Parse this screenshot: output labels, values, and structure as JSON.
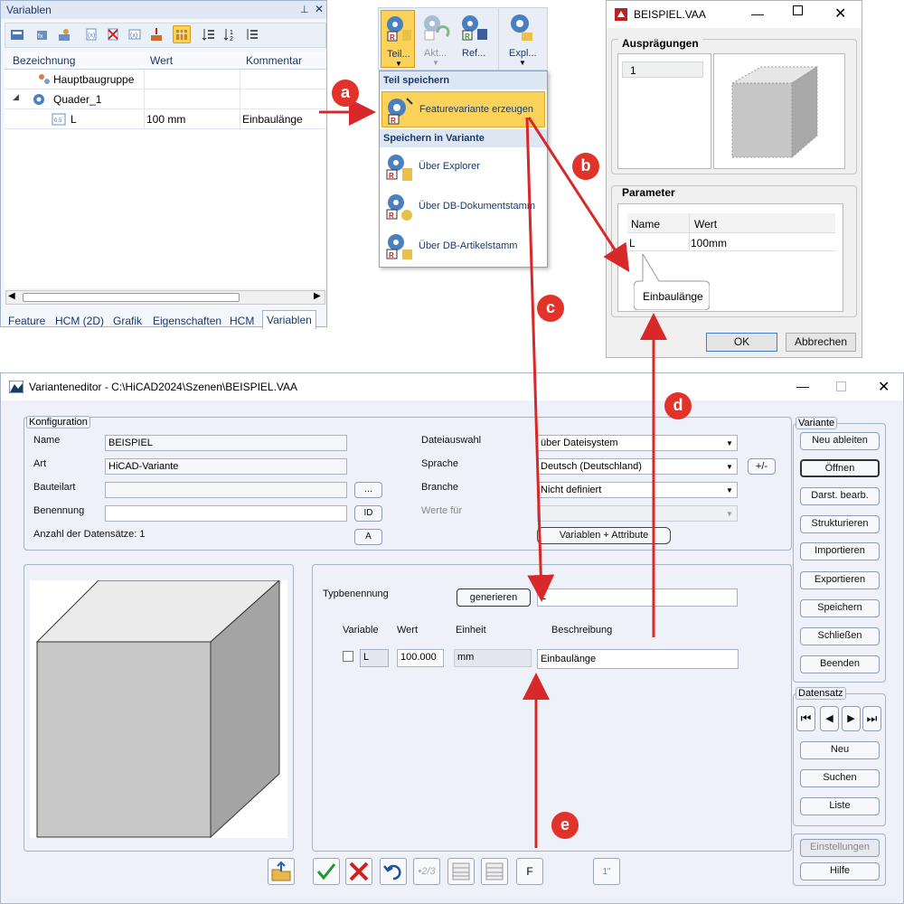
{
  "var_panel": {
    "title": "Variablen",
    "pin": "⊥",
    "close": "✕",
    "columns": [
      "Bezeichnung",
      "Wert",
      "Kommentar"
    ],
    "rows": [
      {
        "name": "Hauptbaugruppe",
        "value": "",
        "comment": ""
      },
      {
        "name": "Quader_1",
        "value": "",
        "comment": ""
      },
      {
        "name": "L",
        "value": "100 mm",
        "comment": "Einbaulänge"
      }
    ],
    "tabs": [
      "Feature",
      "HCM (2D)",
      "Grafik",
      "Eigenschaften",
      "HCM",
      "Variablen"
    ],
    "active_tab": "Variablen"
  },
  "ribbon": {
    "buttons": [
      "Teil...",
      "Akt...",
      "Ref...",
      "Expl..."
    ]
  },
  "dropdown": {
    "section1": "Teil speichern",
    "highlighted": "Featurevariante erzeugen",
    "section2": "Speichern in Variante",
    "items": [
      "Über Explorer",
      "Über DB-Dokumentstamm",
      "Über DB-Artikelstamm"
    ]
  },
  "beispiel_dialog": {
    "title": "BEISPIEL.VAA",
    "auspraegungen_label": "Ausprägungen",
    "auspraegung_value": "1",
    "parameter_label": "Parameter",
    "col_name": "Name",
    "col_wert": "Wert",
    "param_name": "L",
    "param_value": "100mm",
    "tooltip": "Einbaulänge",
    "ok": "OK",
    "cancel": "Abbrechen"
  },
  "editor": {
    "title": "Varianteneditor - C:\\HiCAD2024\\Szenen\\BEISPIEL.VAA",
    "konfiguration_label": "Konfiguration",
    "name_label": "Name",
    "name_value": "BEISPIEL",
    "art_label": "Art",
    "art_value": "HiCAD-Variante",
    "bauteilart_label": "Bauteilart",
    "benennung_label": "Benennung",
    "anzahl": "Anzahl der Datensätze: 1",
    "btn_dots": "...",
    "btn_id": "ID",
    "btn_a": "A",
    "dateiauswahl_label": "Dateiauswahl",
    "dateiauswahl_value": "über Dateisystem",
    "sprache_label": "Sprache",
    "sprache_value": "Deutsch (Deutschland)",
    "branche_label": "Branche",
    "branche_value": "Nicht definiert",
    "werte_fuer_label": "Werte für",
    "plusminus": "+/-",
    "variablen_attribute": "Variablen + Attribute",
    "typbenennung_label": "Typbenennung",
    "generieren": "generieren",
    "typ_value": "L",
    "col_variable": "Variable",
    "col_wert": "Wert",
    "col_einheit": "Einheit",
    "col_beschreibung": "Beschreibung",
    "var_name": "L",
    "var_value": "100.000",
    "var_unit": "mm",
    "var_desc": "Einbaulänge",
    "variante_label": "Variante",
    "variante_buttons": [
      "Neu ableiten",
      "Öffnen",
      "Darst. bearb.",
      "Strukturieren",
      "Importieren",
      "Exportieren",
      "Speichern",
      "Schließen",
      "Beenden"
    ],
    "datensatz_label": "Datensatz",
    "datensatz_buttons": [
      "Neu",
      "Suchen",
      "Liste"
    ],
    "einstellungen": "Einstellungen",
    "hilfe": "Hilfe",
    "bottom_f": "F",
    "bottom_fraction": "•2/3",
    "bottom_one": "1\""
  },
  "markers": [
    "a",
    "b",
    "c",
    "d",
    "e"
  ],
  "colors": {
    "arrow": "#d8282a",
    "marker": "#e2332b",
    "highlight": "#fbd35a",
    "panel_bg": "#eef2f8",
    "header_text": "#1a3a6b"
  }
}
